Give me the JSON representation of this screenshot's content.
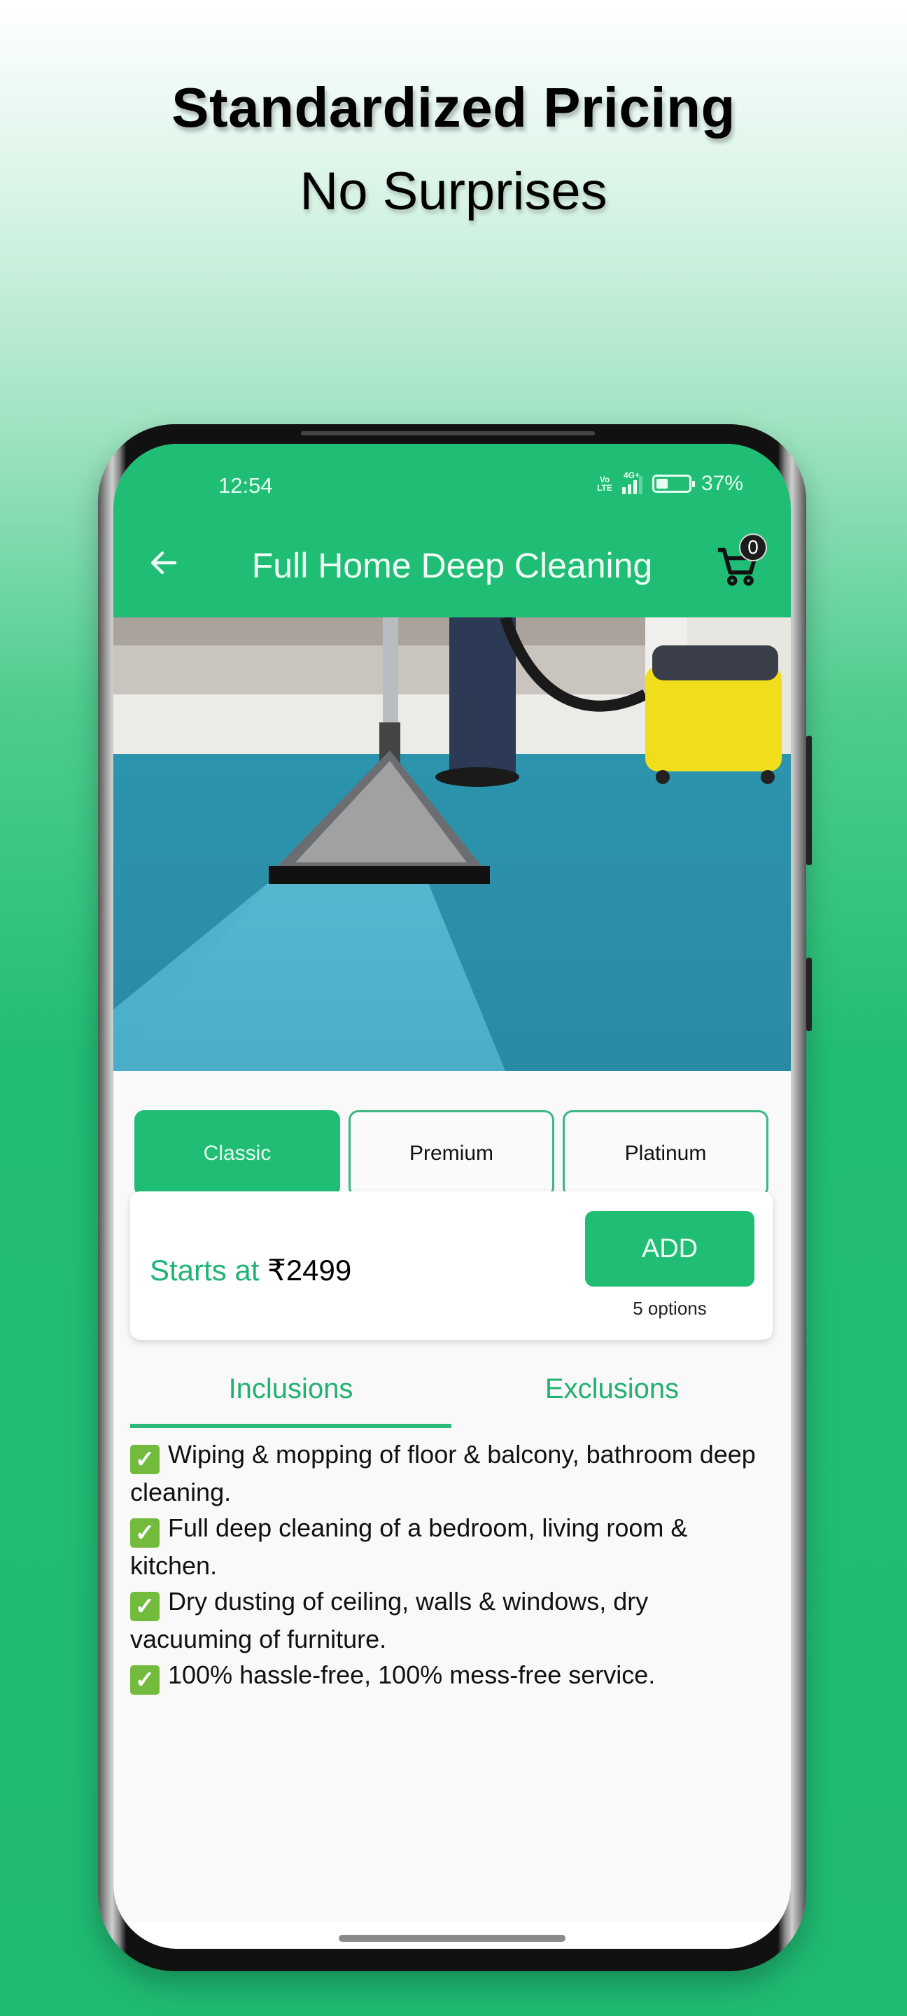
{
  "promo": {
    "headline": "Standardized Pricing",
    "subline": "No Surprises"
  },
  "status_bar": {
    "time": "12:54",
    "volte": "Vo LTE",
    "network": "4G+",
    "battery_percent_label": "37%",
    "battery_level": 0.37
  },
  "app_bar": {
    "title": "Full Home Deep Cleaning",
    "cart_count": "0"
  },
  "hero": {
    "description": "Carpet cleaning with vacuum nozzle on blue carpet, yellow wet-vac in background"
  },
  "variants": [
    {
      "label": "Classic",
      "selected": true
    },
    {
      "label": "Premium",
      "selected": false
    },
    {
      "label": "Platinum",
      "selected": false
    }
  ],
  "pricing": {
    "starts_label": "Starts at",
    "amount": "₹2499",
    "add_label": "ADD",
    "options_label": "5 options"
  },
  "tabs": [
    {
      "label": "Inclusions",
      "active": true
    },
    {
      "label": "Exclusions",
      "active": false
    }
  ],
  "inclusions": [
    "Wiping & mopping of floor & balcony, bathroom deep cleaning.",
    "Full deep cleaning of a bedroom, living room & kitchen.",
    "Dry dusting of ceiling, walls & windows, dry vacuuming of furniture.",
    "100% hassle-free, 100% mess-free service."
  ],
  "colors": {
    "brand_green": "#20bd75",
    "text_green": "#22b170",
    "check_green": "#72bb3c"
  }
}
